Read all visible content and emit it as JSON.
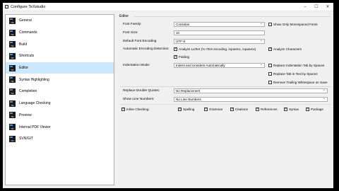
{
  "window": {
    "title": "Configure TeXstudio",
    "minimize_icon": "–",
    "maximize_icon": "☐",
    "close_icon": "✕"
  },
  "sidebar": {
    "icon_text": "TXS",
    "items": [
      {
        "label": "General",
        "selected": false
      },
      {
        "label": "Commands",
        "selected": false
      },
      {
        "label": "Build",
        "selected": false
      },
      {
        "label": "Shortcuts",
        "selected": false
      },
      {
        "label": "Editor",
        "selected": true
      },
      {
        "label": "Syntax Highlighting",
        "selected": false
      },
      {
        "label": "Completion",
        "selected": false
      },
      {
        "label": "Language Checking",
        "selected": false
      },
      {
        "label": "Preview",
        "selected": false
      },
      {
        "label": "Internal PDF Viewer",
        "selected": false
      },
      {
        "label": "SVN/GIT",
        "selected": false
      }
    ]
  },
  "editor": {
    "group_title": "Editor",
    "font_family_label": "Font Family:",
    "font_family_value": "Consolas",
    "show_monospaced_label": "Show Only Monospaced Fonts",
    "font_size_label": "Font Size:",
    "font_size_value": "10",
    "default_encoding_label": "Default Font Encoding",
    "default_encoding_value": "UTF-8",
    "auto_encoding_label": "Automatic Encoding Detection:",
    "analyze_latex_label": "Analyze LaTeX (% !TeX encoding, inputenc, inputenx)",
    "analyze_chars_label": "Analyze Characters",
    "folding_label": "Folding",
    "indentation_label": "Indentation Mode:",
    "indentation_value": "Indent and Unindent Automatically",
    "replace_indent_label": "Replace Indentation Tab by Spaces",
    "replace_tab_label": "Replace Tab in Text by Spaces",
    "remove_trailing_label": "Remove Trailing Whitespace on Save",
    "replace_quotes_label": "Replace Double Quotes:",
    "replace_quotes_value": "No Replacement",
    "line_numbers_label": "Show Line Numbers:",
    "line_numbers_value": "No Line Numbers",
    "inline_checking_label": "Inline Checking:",
    "spelling_label": "Spelling",
    "grammar_label": "Grammar",
    "citations_label": "Citations",
    "references_label": "References",
    "syntax_label": "Syntax",
    "package_label": "Package"
  }
}
